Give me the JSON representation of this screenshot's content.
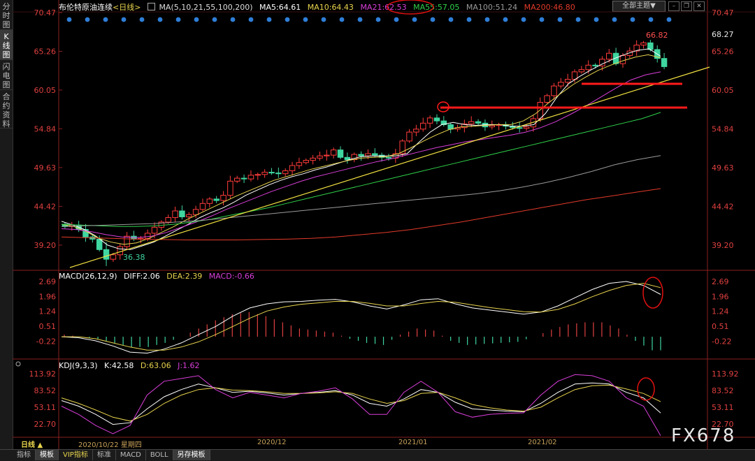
{
  "sidebar": {
    "tabs": [
      {
        "label": "分时图",
        "active": false
      },
      {
        "label": "K线图",
        "active": true
      },
      {
        "label": "闪电图",
        "active": false
      },
      {
        "label": "合约资料",
        "active": false
      }
    ]
  },
  "header": {
    "symbol": "布伦特原油连续",
    "period": "<日线>",
    "ma_params": "MA(5,10,21,55,100,200)",
    "ma5": "MA5:64.61",
    "ma10": "MA10:64.43",
    "ma21": "MA21:62.53",
    "ma55": "MA55:57.05",
    "ma100": "MA100:51.24",
    "ma200": "MA200:46.80",
    "theme_button": "全部主题▼",
    "colors": {
      "ma5": "#ffffff",
      "ma10": "#e8d44d",
      "ma21": "#d93ed9",
      "ma55": "#2fd04a",
      "ma100": "#9a9a9a",
      "ma200": "#e23a2a"
    }
  },
  "macd_header": {
    "title": "MACD(26,12,9)",
    "diff": "DIFF:2.06",
    "dea": "DEA:2.39",
    "macd": "MACD:-0.66"
  },
  "kdj_header": {
    "title": "KDJ(9,3,3)",
    "k": "K:42.58",
    "d": "D:63.06",
    "j": "J:1.62"
  },
  "time_axis": {
    "period_label": "日线 ▲",
    "cursor_date": "2020/10/22 星期四",
    "months": [
      "2020/12",
      "2021/01",
      "2021/02"
    ]
  },
  "bottom_tabs": [
    {
      "label": "指标",
      "active": false
    },
    {
      "label": "模板",
      "active": true
    },
    {
      "label": "VIP指标",
      "active": false
    },
    {
      "label": "标准",
      "active": false
    },
    {
      "label": "MACD",
      "active": false
    },
    {
      "label": "BOLL",
      "active": false
    },
    {
      "label": "另存模板",
      "active": false
    }
  ],
  "watermark": "FX678",
  "chart_data": [
    {
      "type": "candlestick",
      "title": "布伦特原油连续 <日线>",
      "y_ticks": [
        "70.47",
        "65.26",
        "60.05",
        "54.84",
        "49.63",
        "44.42",
        "39.20"
      ],
      "ylim": [
        36.0,
        70.47
      ],
      "last_price_label": "68.27",
      "annotations": {
        "high": "66.82",
        "low": "36.38"
      },
      "close_path": [
        41.7,
        41.9,
        41.3,
        40.3,
        40.0,
        38.6,
        37.3,
        37.9,
        39.0,
        40.4,
        40.0,
        40.1,
        40.8,
        41.6,
        42.3,
        42.9,
        43.8,
        43.0,
        43.3,
        44.0,
        44.8,
        45.4,
        45.2,
        45.9,
        47.8,
        48.2,
        48.1,
        48.6,
        48.7,
        49.0,
        48.9,
        48.8,
        49.2,
        49.9,
        50.3,
        50.6,
        50.9,
        51.2,
        51.3,
        52.0,
        51.0,
        50.7,
        51.4,
        51.2,
        51.5,
        51.3,
        51.0,
        50.9,
        51.5,
        53.2,
        54.4,
        54.8,
        55.6,
        56.3,
        55.9,
        55.4,
        54.8,
        55.0,
        55.5,
        55.8,
        55.6,
        55.1,
        55.3,
        55.4,
        55.2,
        55.0,
        54.9,
        55.1,
        56.2,
        58.4,
        59.3,
        60.6,
        61.1,
        61.5,
        62.5,
        62.8,
        63.4,
        63.3,
        64.2,
        65.0,
        63.6,
        64.7,
        65.3,
        66.1,
        66.4,
        65.5,
        64.3,
        63.2
      ],
      "ma_series": [
        {
          "name": "MA5",
          "color": "#ffffff",
          "values": [
            42.4,
            41.9,
            41.3,
            40.4,
            39.2,
            38.7,
            38.6,
            39.1,
            39.6,
            40.4,
            41.2,
            42.0,
            42.9,
            43.6,
            44.2,
            45.0,
            45.9,
            46.6,
            47.3,
            47.9,
            48.4,
            48.8,
            49.3,
            49.7,
            50.2,
            50.7,
            51.1,
            51.2,
            51.2,
            51.2,
            51.5,
            53.0,
            54.4,
            55.4,
            55.7,
            55.4,
            55.3,
            55.4,
            55.4,
            55.2,
            55.2,
            55.4,
            56.9,
            59.1,
            60.9,
            61.9,
            62.8,
            63.6,
            64.3,
            64.9,
            65.4,
            65.6,
            64.6
          ]
        },
        {
          "name": "MA10",
          "color": "#e8d44d",
          "values": [
            42.0,
            41.7,
            41.0,
            40.1,
            39.6,
            39.3,
            39.5,
            40.1,
            40.9,
            41.7,
            42.6,
            43.4,
            44.2,
            45.0,
            45.8,
            46.5,
            47.2,
            47.9,
            48.4,
            48.9,
            49.4,
            49.8,
            50.2,
            50.6,
            50.9,
            51.0,
            51.1,
            51.5,
            52.3,
            53.2,
            54.0,
            54.7,
            55.1,
            55.2,
            55.3,
            55.4,
            55.4,
            55.9,
            56.9,
            58.3,
            59.6,
            60.8,
            61.8,
            62.7,
            63.4,
            64.0,
            64.5,
            64.8,
            64.4
          ]
        },
        {
          "name": "MA21",
          "color": "#d93ed9",
          "values": [
            41.4,
            41.3,
            41.0,
            40.6,
            40.3,
            40.2,
            40.4,
            40.9,
            41.6,
            42.3,
            43.1,
            44.0,
            44.8,
            45.6,
            46.4,
            47.1,
            47.8,
            48.4,
            48.9,
            49.4,
            49.9,
            50.4,
            50.8,
            51.3,
            51.8,
            52.3,
            52.7,
            53.1,
            53.4,
            53.7,
            54.0,
            54.4,
            55.0,
            55.8,
            56.8,
            57.9,
            59.1,
            60.3,
            61.4,
            62.1,
            62.5
          ]
        },
        {
          "name": "MA55",
          "color": "#2fd04a",
          "values": [
            42.0,
            41.9,
            41.8,
            41.7,
            41.7,
            41.8,
            42.0,
            42.3,
            42.7,
            43.2,
            43.7,
            44.2,
            44.8,
            45.4,
            46.0,
            46.6,
            47.2,
            47.8,
            48.4,
            49.0,
            49.6,
            50.2,
            50.8,
            51.4,
            52.0,
            52.6,
            53.2,
            53.8,
            54.4,
            55.0,
            55.6,
            56.2,
            57.05
          ]
        },
        {
          "name": "MA100",
          "color": "#9a9a9a",
          "values": [
            41.7,
            41.8,
            41.9,
            42.0,
            42.1,
            42.3,
            42.5,
            42.8,
            43.1,
            43.4,
            43.7,
            44.0,
            44.3,
            44.6,
            44.9,
            45.2,
            45.5,
            45.8,
            46.1,
            46.5,
            47.0,
            47.6,
            48.3,
            49.1,
            50.0,
            50.7,
            51.24
          ]
        },
        {
          "name": "MA200",
          "color": "#e23a2a",
          "values": [
            40.3,
            40.2,
            40.1,
            40.0,
            39.95,
            39.9,
            39.9,
            39.9,
            39.95,
            40.0,
            40.1,
            40.3,
            40.6,
            40.9,
            41.3,
            41.8,
            42.3,
            42.9,
            43.5,
            44.1,
            44.7,
            45.3,
            45.8,
            46.3,
            46.8
          ]
        }
      ]
    },
    {
      "type": "line",
      "title": "MACD(26,12,9)",
      "y_ticks": [
        "2.69",
        "1.96",
        "1.24",
        "0.51",
        "-0.22"
      ],
      "ylim": [
        -0.95,
        2.69
      ],
      "series": [
        {
          "name": "DIFF",
          "color": "#ffffff",
          "values": [
            0.0,
            -0.05,
            -0.2,
            -0.45,
            -0.75,
            -0.8,
            -0.6,
            -0.3,
            0.1,
            0.5,
            1.0,
            1.4,
            1.6,
            1.7,
            1.72,
            1.78,
            1.82,
            1.7,
            1.5,
            1.35,
            1.55,
            1.8,
            1.85,
            1.6,
            1.4,
            1.3,
            1.2,
            1.1,
            1.2,
            1.5,
            1.9,
            2.3,
            2.6,
            2.69,
            2.5,
            2.06
          ]
        },
        {
          "name": "DEA",
          "color": "#e8d44d",
          "values": [
            0.0,
            0.0,
            -0.1,
            -0.3,
            -0.5,
            -0.65,
            -0.65,
            -0.5,
            -0.25,
            0.1,
            0.5,
            0.9,
            1.25,
            1.45,
            1.58,
            1.65,
            1.72,
            1.72,
            1.63,
            1.5,
            1.5,
            1.62,
            1.72,
            1.68,
            1.55,
            1.42,
            1.32,
            1.22,
            1.2,
            1.33,
            1.6,
            1.95,
            2.25,
            2.5,
            2.6,
            2.39
          ]
        }
      ],
      "histogram": [
        0.1,
        0.0,
        -0.1,
        -0.3,
        -0.5,
        -0.5,
        -0.3,
        0.0,
        0.4,
        0.8,
        1.1,
        1.2,
        1.0,
        0.7,
        0.4,
        0.3,
        0.2,
        -0.1,
        -0.3,
        -0.4,
        0.1,
        0.4,
        0.3,
        -0.2,
        -0.4,
        -0.35,
        -0.3,
        -0.25,
        0.0,
        0.35,
        0.6,
        0.7,
        0.7,
        0.4,
        -0.2,
        -0.66
      ]
    },
    {
      "type": "line",
      "title": "KDJ(9,3,3)",
      "y_ticks": [
        "113.92",
        "83.52",
        "53.11",
        "22.70"
      ],
      "ylim": [
        0,
        120
      ],
      "series": [
        {
          "name": "K",
          "color": "#ffffff",
          "values": [
            65,
            55,
            40,
            22,
            25,
            50,
            72,
            85,
            95,
            88,
            80,
            82,
            79,
            75,
            78,
            80,
            83,
            75,
            60,
            55,
            68,
            85,
            80,
            62,
            50,
            48,
            46,
            45,
            60,
            80,
            95,
            97,
            95,
            80,
            70,
            42.58
          ]
        },
        {
          "name": "D",
          "color": "#e8d44d",
          "values": [
            70,
            60,
            48,
            35,
            28,
            40,
            60,
            75,
            85,
            88,
            84,
            83,
            81,
            78,
            78,
            79,
            81,
            78,
            68,
            60,
            65,
            78,
            80,
            70,
            58,
            52,
            48,
            46,
            53,
            70,
            85,
            92,
            93,
            86,
            78,
            63.06
          ]
        },
        {
          "name": "J",
          "color": "#d93ed9",
          "values": [
            55,
            40,
            20,
            5,
            20,
            75,
            100,
            105,
            110,
            85,
            70,
            80,
            75,
            70,
            78,
            82,
            88,
            68,
            40,
            40,
            80,
            100,
            80,
            45,
            35,
            40,
            42,
            43,
            75,
            100,
            112,
            110,
            100,
            70,
            55,
            1.62
          ]
        }
      ]
    }
  ]
}
